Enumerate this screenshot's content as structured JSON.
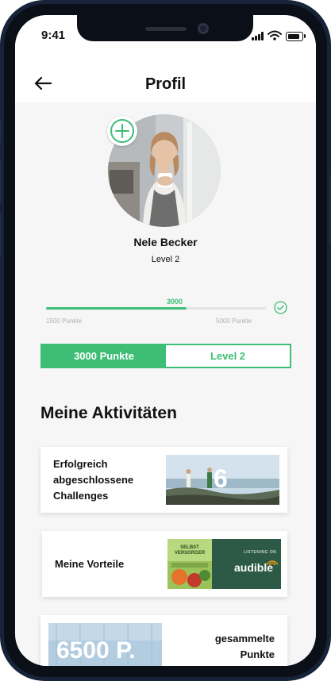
{
  "status_bar": {
    "time": "9:41"
  },
  "header": {
    "title": "Profil",
    "back_icon": "arrow-left-icon"
  },
  "profile": {
    "name": "Nele Becker",
    "level": "Level 2",
    "add_icon": "plus-circle-icon"
  },
  "progress": {
    "current_label": "3000",
    "min_label": "1500 Punkte",
    "max_label": "5000 Punkte",
    "fraction": 0.64,
    "check_icon": "check-circle-icon"
  },
  "segment": {
    "points_label": "3000 Punkte",
    "level_label": "Level 2",
    "active": "points"
  },
  "activities": {
    "title": "Meine Aktivitäten",
    "cards": [
      {
        "label_lines": [
          "Erfolgreich",
          "abgeschlossene",
          "Challenges"
        ],
        "badge": "6"
      },
      {
        "label": "Meine Vorteile",
        "book_title_lines": [
          "SELBST",
          "VERSORGER"
        ],
        "service_top": "LISTENING ON",
        "service_name": "audible"
      },
      {
        "label_lines": [
          "gesammelte",
          "Punkte"
        ],
        "badge": "6500 P."
      }
    ]
  },
  "colors": {
    "accent": "#3dbd75",
    "frame": "#172338",
    "background": "#f6f6f6"
  }
}
